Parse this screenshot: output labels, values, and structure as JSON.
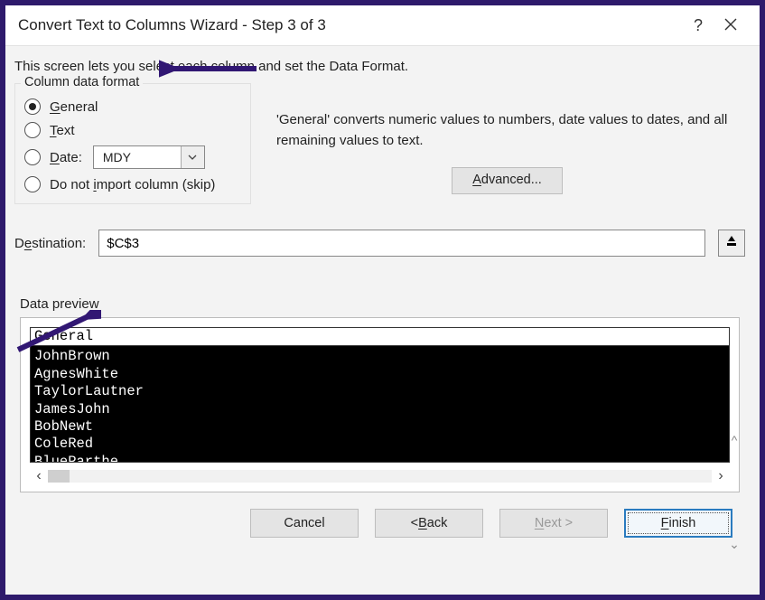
{
  "title": "Convert Text to Columns Wizard - Step 3 of 3",
  "intro": "This screen lets you select each column and set the Data Format.",
  "format": {
    "legend": "Column data format",
    "general": "General",
    "text": "Text",
    "date_label": "Date:",
    "date_value": "MDY",
    "skip": "Do not import column (skip)",
    "selected": "general",
    "hint": "'General' converts numeric values to numbers, date values to dates, and all remaining values to text.",
    "advanced": "Advanced..."
  },
  "destination": {
    "label": "Destination:",
    "value": "$C$3"
  },
  "preview": {
    "label": "Data preview",
    "header": "General",
    "rows": [
      "JohnBrown",
      "AgnesWhite",
      "TaylorLautner",
      "JamesJohn",
      "BobNewt",
      "ColeRed",
      "BlueParthe"
    ]
  },
  "buttons": {
    "cancel": "Cancel",
    "back": "< Back",
    "next": "Next >",
    "finish": "Finish"
  }
}
